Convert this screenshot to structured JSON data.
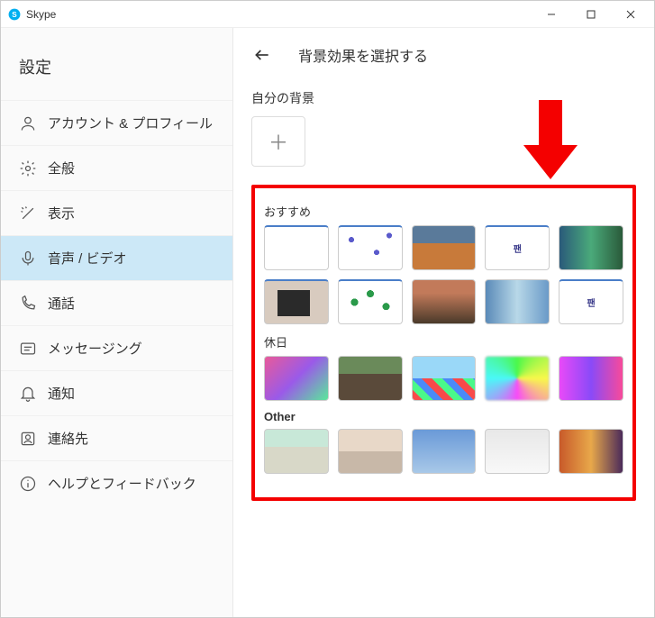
{
  "titlebar": {
    "title": "Skype"
  },
  "sidebar": {
    "heading": "設定",
    "items": [
      {
        "label": "アカウント & プロフィール"
      },
      {
        "label": "全般"
      },
      {
        "label": "表示"
      },
      {
        "label": "音声 / ビデオ"
      },
      {
        "label": "通話"
      },
      {
        "label": "メッセージング"
      },
      {
        "label": "通知"
      },
      {
        "label": "連絡先"
      },
      {
        "label": "ヘルプとフィードバック"
      }
    ],
    "selected_index": 3
  },
  "content": {
    "title": "背景効果を選択する",
    "own_bg_label": "自分の背景",
    "categories": [
      {
        "label": "おすすめ",
        "count": 10
      },
      {
        "label": "休日",
        "count": 5
      },
      {
        "label": "Other",
        "count": 5
      }
    ]
  },
  "annotation": {
    "arrow_color": "#f40000"
  }
}
